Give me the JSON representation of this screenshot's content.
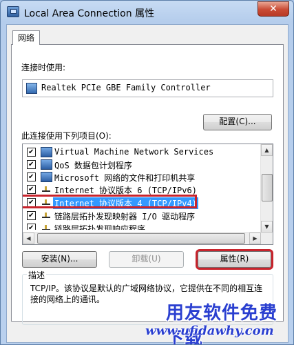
{
  "window": {
    "title": "Local Area Connection 属性",
    "close_glyph": "✕"
  },
  "tabs": [
    {
      "label": "网络"
    }
  ],
  "connect_using": {
    "label": "连接时使用:",
    "adapter": "Realtek PCIe GBE Family Controller",
    "configure_button": "配置(C)..."
  },
  "items_section": {
    "label": "此连接使用下列项目(O):",
    "items": [
      {
        "label": "Virtual Machine Network Services",
        "checked": true,
        "icon": "network-client-icon"
      },
      {
        "label": "QoS 数据包计划程序",
        "checked": true,
        "icon": "network-client-icon"
      },
      {
        "label": "Microsoft 网络的文件和打印机共享",
        "checked": true,
        "icon": "network-client-icon"
      },
      {
        "label": "Internet 协议版本 6 (TCP/IPv6)",
        "checked": true,
        "icon": "protocol-icon"
      },
      {
        "label": "Internet 协议版本 4 (TCP/IPv4)",
        "checked": true,
        "icon": "protocol-icon",
        "selected": true
      },
      {
        "label": "链路层拓扑发现映射器 I/O 驱动程序",
        "checked": true,
        "icon": "protocol-icon"
      },
      {
        "label": "链路层拓扑发现响应程序",
        "checked": true,
        "icon": "protocol-icon"
      }
    ]
  },
  "buttons": {
    "install": "安装(N)...",
    "uninstall": "卸载(U)",
    "properties": "属性(R)"
  },
  "description": {
    "title": "描述",
    "text": "TCP/IP。该协议是默认的广域网络协议，它提供在不同的相互连接的网络上的通讯。"
  },
  "watermark": {
    "brand": "用友软件免费下载",
    "url": "www.ufidawhy.com"
  },
  "colors": {
    "selection": "#3399ff",
    "highlight_box": "#c8232c",
    "watermark": "#2a3fd0"
  }
}
